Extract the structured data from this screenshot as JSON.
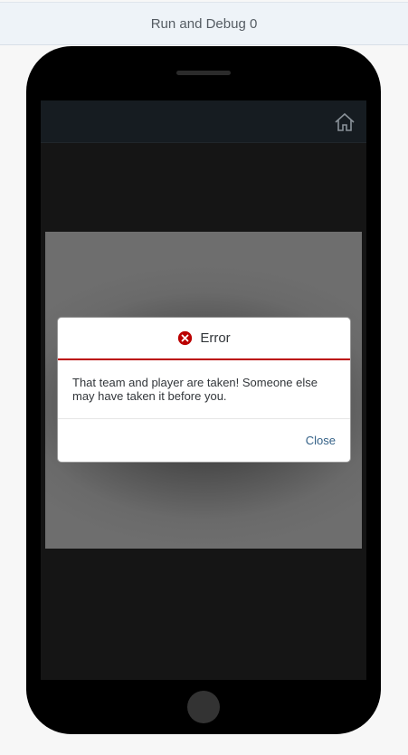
{
  "topbar": {
    "title": "Run and Debug 0"
  },
  "app_header": {
    "home_icon": "home-icon"
  },
  "dialog": {
    "title": "Error",
    "status_icon": "error-icon",
    "message": "That team and player are taken! Someone else may have taken it before you.",
    "close_label": "Close",
    "accent_color": "#bb0000",
    "link_color": "#346187"
  }
}
